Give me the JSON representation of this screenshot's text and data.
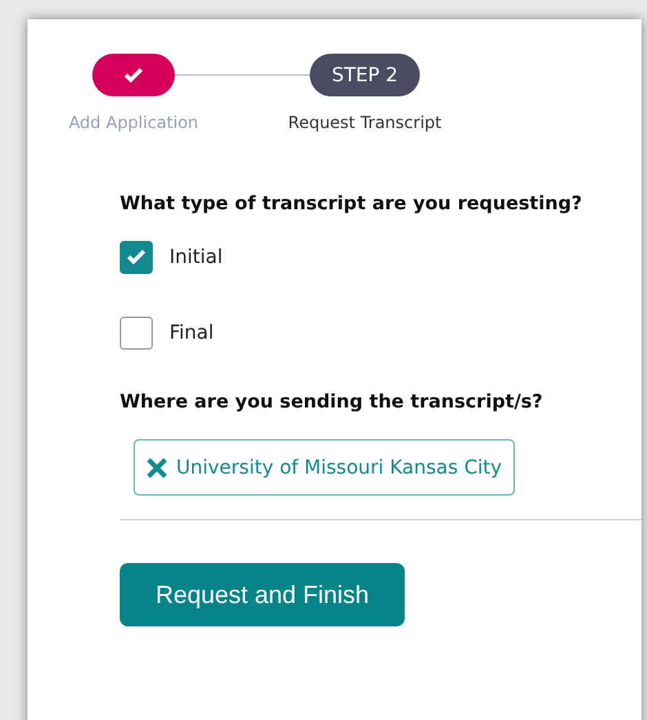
{
  "steps": [
    {
      "label": "Add Application",
      "completed": true
    },
    {
      "badge": "STEP 2",
      "label": "Request Transcript",
      "completed": false
    }
  ],
  "transcript_type": {
    "question": "What type of transcript are you requesting?",
    "options": [
      {
        "label": "Initial",
        "checked": true
      },
      {
        "label": "Final",
        "checked": false
      }
    ]
  },
  "destination": {
    "question": "Where are you sending the transcript/s?",
    "chips": [
      "University of Missouri Kansas City"
    ]
  },
  "submit_button": "Request and Finish"
}
